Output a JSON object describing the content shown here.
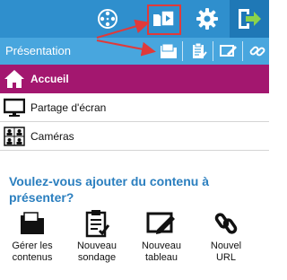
{
  "toolbar": {
    "icons": [
      "film-reel-icon",
      "presentation-content-icon",
      "gear-icon",
      "exit-icon"
    ],
    "highlight_color": "#e03a3a"
  },
  "subbar": {
    "title": "Présentation",
    "icons": [
      "folder-icon",
      "poll-icon",
      "edit-board-icon",
      "link-icon"
    ]
  },
  "menu": {
    "items": [
      {
        "label": "Accueil",
        "icon": "home-icon",
        "active": true
      },
      {
        "label": "Partage d'écran",
        "icon": "monitor-icon",
        "active": false
      },
      {
        "label": "Caméras",
        "icon": "cameras-icon",
        "active": false
      }
    ]
  },
  "content": {
    "question": "Voulez-vous ajouter du contenu à présenter?",
    "actions": [
      {
        "label": "Gérer les\ncontenus",
        "icon": "folder-icon"
      },
      {
        "label": "Nouveau\nsondage",
        "icon": "poll-icon"
      },
      {
        "label": "Nouveau\ntableau",
        "icon": "whiteboard-icon"
      },
      {
        "label": "Nouvel\nURL",
        "icon": "link-icon"
      }
    ]
  },
  "colors": {
    "toolbar": "#2f8fcd",
    "subbar": "#48a6de",
    "active_item": "#a3176f",
    "question_text": "#2b7fbf"
  }
}
